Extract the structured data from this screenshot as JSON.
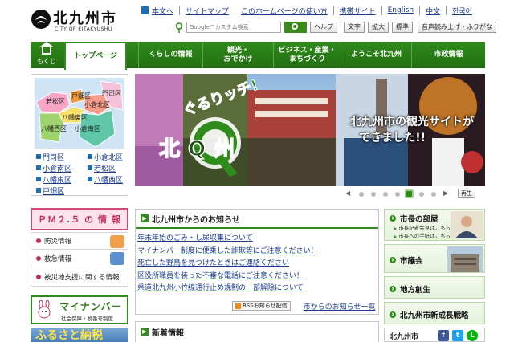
{
  "header": {
    "logo_title": "北九州市",
    "logo_sub": "CITY OF KITAKYUSHU",
    "util_links": [
      "本文へ",
      "サイトマップ",
      "このホームページの使い方",
      "携帯サイト",
      "English",
      "中文",
      "한국어"
    ],
    "search_placeholder": "Google™カスタム検索",
    "buttons": {
      "help": "ヘルプ",
      "text": "文字",
      "zoom": "拡大",
      "standard": "標準",
      "voice": "音声読み上げ・ふりがな"
    }
  },
  "nav": {
    "home": "もくじ",
    "tabs": [
      "トップページ",
      "くらしの情報",
      "観光・\nおでかけ",
      "ビジネス・産業・\nまちづくり",
      "ようこそ北九州",
      "市政情報"
    ]
  },
  "map": {
    "labels": [
      "若松区",
      "戸畑区",
      "門司区",
      "小倉北区",
      "八幡東区",
      "八幡西区",
      "小倉南区"
    ],
    "ward_links": [
      "門司区",
      "小倉北区",
      "小倉南区",
      "若松区",
      "八幡東区",
      "八幡西区",
      "戸畑区"
    ]
  },
  "sidebar": {
    "pm_label": "ＰＭ２.５ の 情 報",
    "links": [
      "防災情報",
      "救急情報",
      "被災地支援に関する情報"
    ],
    "mynumber_title": "マイナンバー",
    "mynumber_sub": "社会保障・税番号制度",
    "furusato": "ふるさと納税"
  },
  "hero": {
    "logo_text_1": "ぐるりッチ!",
    "logo_text_2": "北Q州",
    "caption_1": "北九州市の観光サイトが",
    "caption_2": "できました!!",
    "slide_count": 8,
    "active_slide": 6,
    "play_label": "再生"
  },
  "news": {
    "title": "北九州市からのお知らせ",
    "items": [
      "年末年始のごみ・し尿収集について",
      "マイナンバー制度に便乗した詐欺等にご注意ください！",
      "死亡した野鳥を見つけたときはご連絡ください",
      "区役所職員を装った不審な電話にご注意ください！",
      "県道北九州小竹線通行止め規制の一部解除について"
    ],
    "rss": "RSSお知らせ配信",
    "more": "市からのお知らせ一覧"
  },
  "new_info": {
    "title": "新着情報"
  },
  "right": {
    "mayor_title": "市長の部屋",
    "mayor_sub1": "市長記者会見はこちら",
    "mayor_sub2": "市長への手紙はこちら",
    "council": "市議会",
    "regional": "地方創生",
    "growth": "北九州市新成長戦略",
    "city_label": "北九州市"
  },
  "colors": {
    "primary_green": "#2f8b1b",
    "link_blue": "#1a3c8c",
    "pm_pink": "#d04a78"
  }
}
